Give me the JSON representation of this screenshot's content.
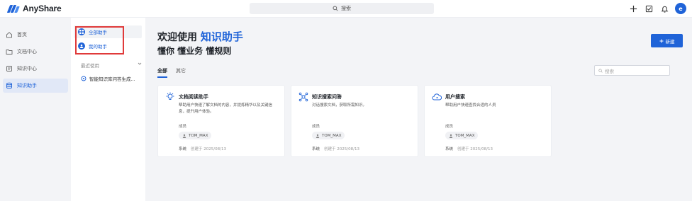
{
  "app": {
    "name": "AnyShare"
  },
  "topbar": {
    "search_label": "搜索",
    "avatar_letter": "e"
  },
  "rail": {
    "items": [
      {
        "label": "首页",
        "icon": "home-icon",
        "active": false
      },
      {
        "label": "文档中心",
        "icon": "folder-icon",
        "active": false
      },
      {
        "label": "知识中心",
        "icon": "knowledge-icon",
        "active": false
      },
      {
        "label": "知识助手",
        "icon": "database-icon",
        "active": true
      }
    ]
  },
  "subnav": {
    "all_assistants": "全部助手",
    "my_assistants": "我的助手",
    "recent_header": "最近使用",
    "recent_items": [
      "智能知识库问答生成..."
    ]
  },
  "main": {
    "welcome_prefix": "欢迎使用",
    "welcome_highlight": "知识助手",
    "slogan": "懂你 懂业务 懂规则",
    "new_button": "新建",
    "tabs": [
      {
        "label": "全部",
        "active": true
      },
      {
        "label": "其它",
        "active": false
      }
    ],
    "filter_placeholder": "搜索",
    "cards": [
      {
        "title": "文档阅读助手",
        "desc": "帮助用户快速了解文档的内容，并提炼精华以及关键信息，提升用户体验。",
        "members_label": "成员",
        "tag": "TOM_MAX",
        "owner": "系统",
        "created": "创建于 2025/08/13",
        "icon": "bulb-icon"
      },
      {
        "title": "知识搜索问答",
        "desc": "对话搜索文档，获取所需知识。",
        "members_label": "成员",
        "tag": "TOM_MAX",
        "owner": "系统",
        "created": "创建于 2025/08/13",
        "icon": "network-icon"
      },
      {
        "title": "用户搜索",
        "desc": "帮助用户快速查找合适的人员",
        "members_label": "成员",
        "tag": "TOM_MAX",
        "owner": "系统",
        "created": "创建于 2025/08/13",
        "icon": "cloud-user-icon"
      }
    ]
  },
  "colors": {
    "accent": "#1f63d8",
    "highlight_box": "#e03a3a"
  }
}
